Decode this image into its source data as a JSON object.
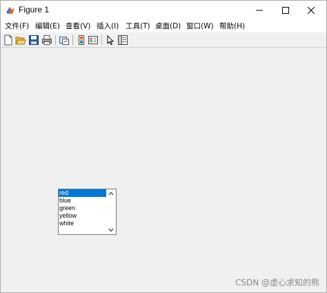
{
  "window": {
    "title": "Figure 1"
  },
  "menubar": {
    "items": [
      {
        "label": "文件(F)"
      },
      {
        "label": "编辑(E)"
      },
      {
        "label": "查看(V)"
      },
      {
        "label": "插入(I)"
      },
      {
        "label": "工具(T)"
      },
      {
        "label": "桌面(D)"
      },
      {
        "label": "窗口(W)"
      },
      {
        "label": "帮助(H)"
      }
    ]
  },
  "toolbar": {
    "buttons": [
      {
        "icon": "new-file-icon"
      },
      {
        "icon": "open-folder-icon"
      },
      {
        "icon": "save-icon"
      },
      {
        "icon": "print-icon"
      },
      {
        "icon": "link-figure-icon"
      },
      {
        "icon": "colorbar-icon"
      },
      {
        "icon": "legend-icon"
      },
      {
        "icon": "cursor-icon"
      },
      {
        "icon": "property-inspector-icon"
      }
    ]
  },
  "listbox": {
    "items": [
      "red",
      "blue",
      "green",
      "yellow",
      "white"
    ],
    "selected": "red"
  },
  "watermark": "CSDN @虚心求知的熊",
  "colors": {
    "selection": "#0078d7",
    "background": "#f0f0f0"
  }
}
